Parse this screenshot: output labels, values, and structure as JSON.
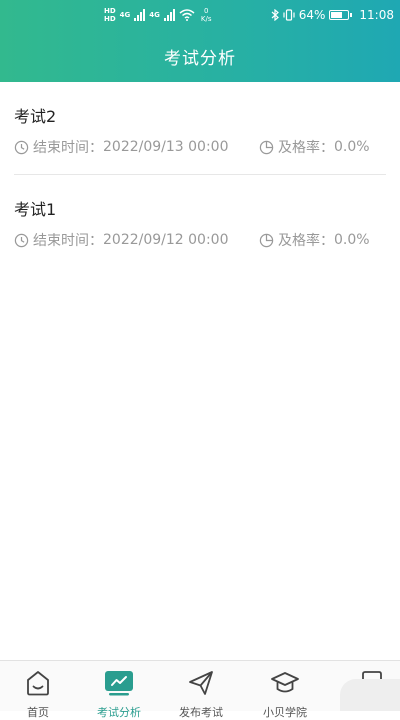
{
  "status_bar": {
    "tag_top": "HD",
    "tag_bottom": "HD",
    "sig_tag_1": "4G",
    "sig_tag_2": "4G",
    "speed_value": "0",
    "speed_unit": "K/s",
    "battery": "64%",
    "time": "11:08"
  },
  "header": {
    "title": "考试分析"
  },
  "exams": [
    {
      "title": "考试2",
      "end_label": "结束时间：",
      "end_time": "2022/09/13 00:00",
      "pass_label": "及格率：",
      "pass_rate": "0.0%"
    },
    {
      "title": "考试1",
      "end_label": "结束时间：",
      "end_time": "2022/09/12 00:00",
      "pass_label": "及格率：",
      "pass_rate": "0.0%"
    }
  ],
  "tabbar": {
    "active_color": "#2a9d8f",
    "items": [
      {
        "label": "首页",
        "icon": "home-icon"
      },
      {
        "label": "考试分析",
        "icon": "analysis-icon"
      },
      {
        "label": "发布考试",
        "icon": "send-icon"
      },
      {
        "label": "小贝学院",
        "icon": "graduation-cap-icon"
      },
      {
        "label": "",
        "icon": "document-icon"
      }
    ]
  },
  "colors": {
    "header_start": "#32b98e",
    "header_end": "#1fa8b3",
    "meta_text": "#999999"
  }
}
